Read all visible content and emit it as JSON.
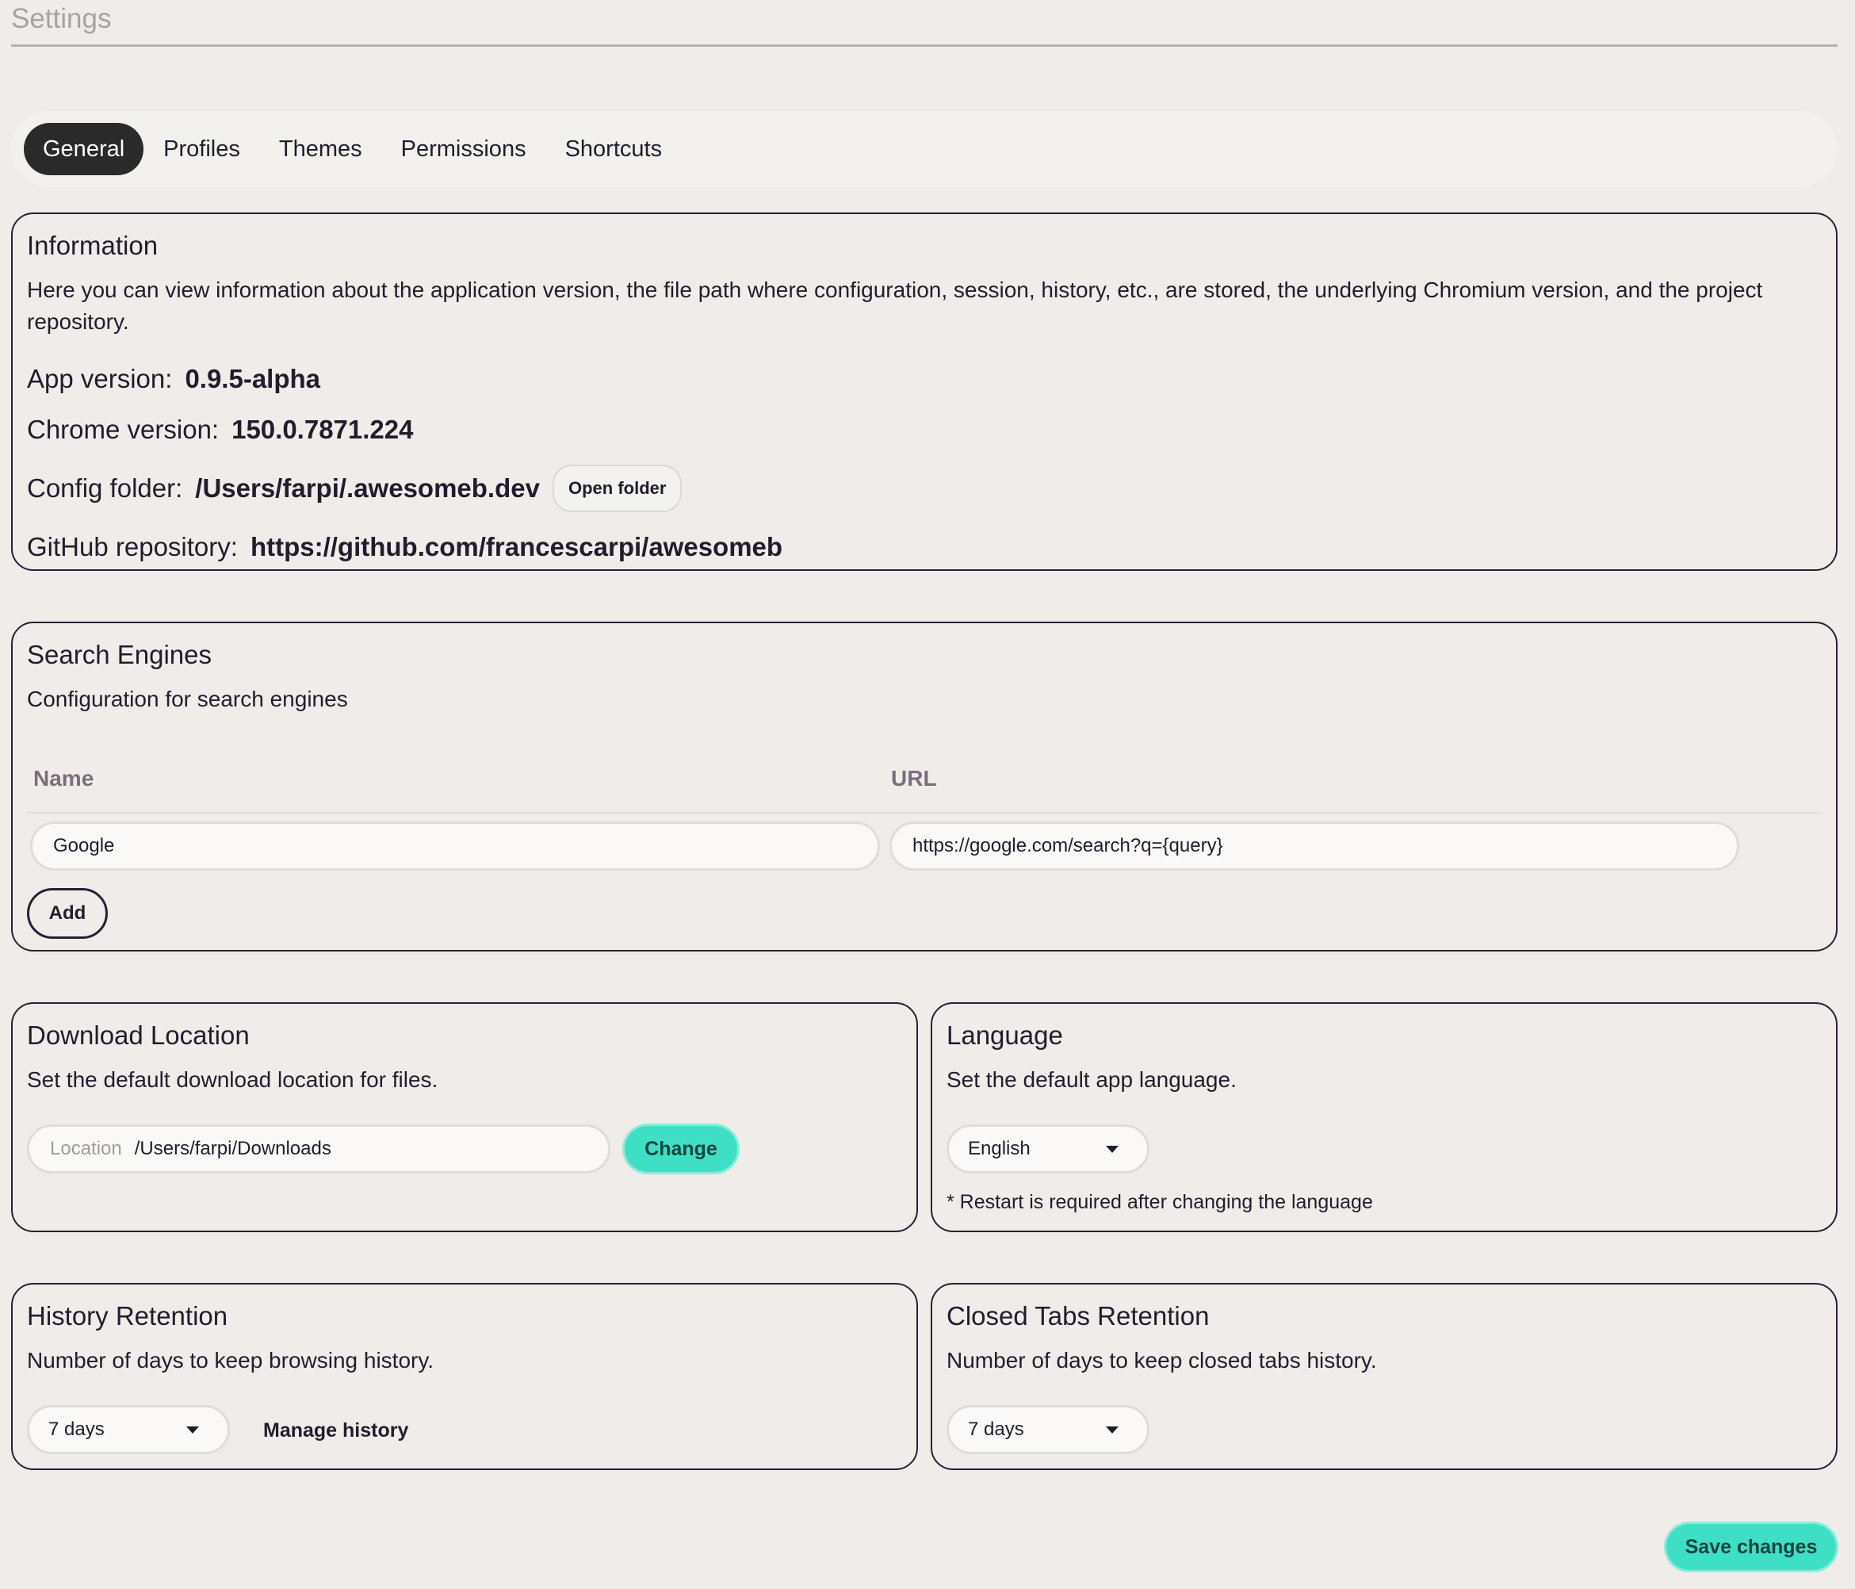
{
  "header": {
    "title": "Settings"
  },
  "tabs": [
    {
      "label": "General",
      "active": true
    },
    {
      "label": "Profiles",
      "active": false
    },
    {
      "label": "Themes",
      "active": false
    },
    {
      "label": "Permissions",
      "active": false
    },
    {
      "label": "Shortcuts",
      "active": false
    }
  ],
  "information": {
    "title": "Information",
    "description": "Here you can view information about the application version, the file path where configuration, session, history, etc., are stored, the underlying Chromium version, and the project repository.",
    "app_version_label": "App version:",
    "app_version": "0.9.5-alpha",
    "chrome_version_label": "Chrome version:",
    "chrome_version": "150.0.7871.224",
    "config_folder_label": "Config folder:",
    "config_folder": "/Users/farpi/.awesomeb.dev",
    "open_folder_label": "Open folder",
    "github_label": "GitHub repository:",
    "github_url": "https://github.com/francescarpi/awesomeb"
  },
  "search_engines": {
    "title": "Search Engines",
    "description": "Configuration for search engines",
    "columns": [
      "Name",
      "URL"
    ],
    "rows": [
      {
        "name": "Google",
        "url": "https://google.com/search?q={query}"
      }
    ],
    "add_label": "Add"
  },
  "download_location": {
    "title": "Download Location",
    "description": "Set the default download location for files.",
    "input_label": "Location",
    "value": "/Users/farpi/Downloads",
    "change_label": "Change"
  },
  "language": {
    "title": "Language",
    "description": "Set the default app language.",
    "selected": "English",
    "note": "* Restart is required after changing the language"
  },
  "history_retention": {
    "title": "History Retention",
    "description": "Number of days to keep browsing history.",
    "selected": "7 days",
    "manage_label": "Manage history"
  },
  "closed_tabs_retention": {
    "title": "Closed Tabs Retention",
    "description": "Number of days to keep closed tabs history.",
    "selected": "7 days"
  },
  "footer": {
    "save_label": "Save changes"
  },
  "colors": {
    "accent": "#3fdfc5",
    "background": "#efecea",
    "border": "#2a2035",
    "active_tab": "#2a2a2a"
  },
  "icons": {
    "select_caret": "caret-down-icon"
  }
}
